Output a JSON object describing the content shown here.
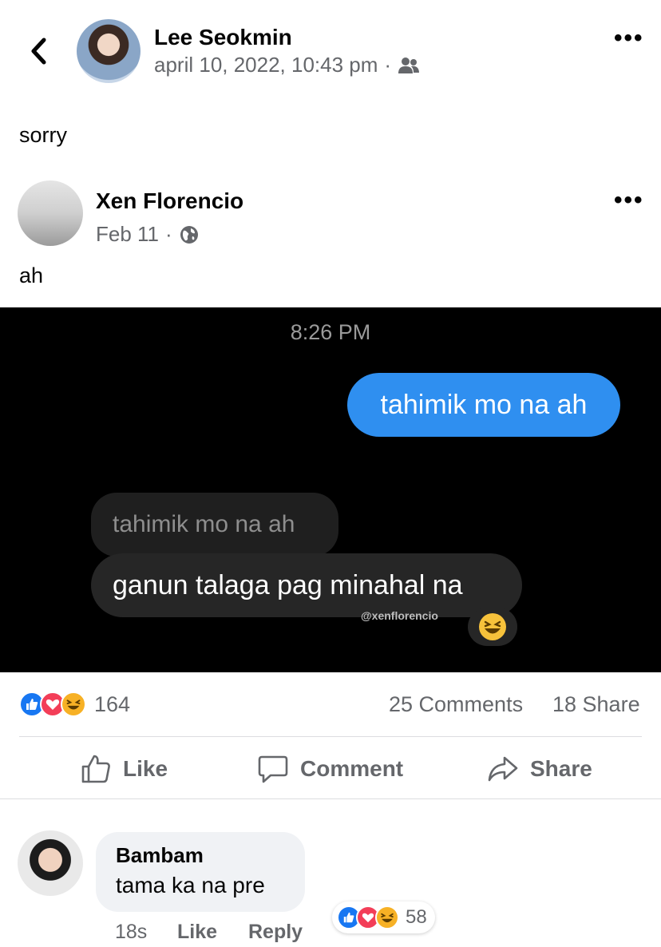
{
  "post": {
    "author": "Lee Seokmin",
    "timestamp": "april 10, 2022, 10:43 pm",
    "separator": "·",
    "text": "sorry"
  },
  "shared": {
    "author": "Xen Florencio",
    "timestamp": "Feb 11",
    "separator": "·",
    "text": "ah",
    "image": {
      "time": "8:26 PM",
      "sent_message": "tahimik mo na ah",
      "quoted_message": "tahimik mo na ah",
      "reply_message": "ganun talaga pag minahal na",
      "watermark": "@xenflorencio",
      "reaction": "😆"
    }
  },
  "stats": {
    "reaction_count": "164",
    "comments": "25 Comments",
    "shares": "18 Share"
  },
  "actions": {
    "like": "Like",
    "comment": "Comment",
    "share": "Share"
  },
  "comment": {
    "author": "Bambam",
    "text": "tama ka na pre",
    "time": "18s",
    "like": "Like",
    "reply": "Reply",
    "reaction_count": "58"
  },
  "more_glyph": "•••",
  "colors": {
    "like_blue": "#1877f2",
    "love_red": "#f33e58",
    "haha_yellow": "#f7b125",
    "message_blue": "#2f8ff0",
    "secondary_text": "#65676b"
  },
  "icons": [
    "back-chevron-icon",
    "friends-audience-icon",
    "globe-icon",
    "more-options-icon",
    "thumbs-up-icon",
    "comment-icon",
    "share-arrow-icon",
    "like-reaction-icon",
    "love-reaction-icon",
    "haha-reaction-icon"
  ]
}
